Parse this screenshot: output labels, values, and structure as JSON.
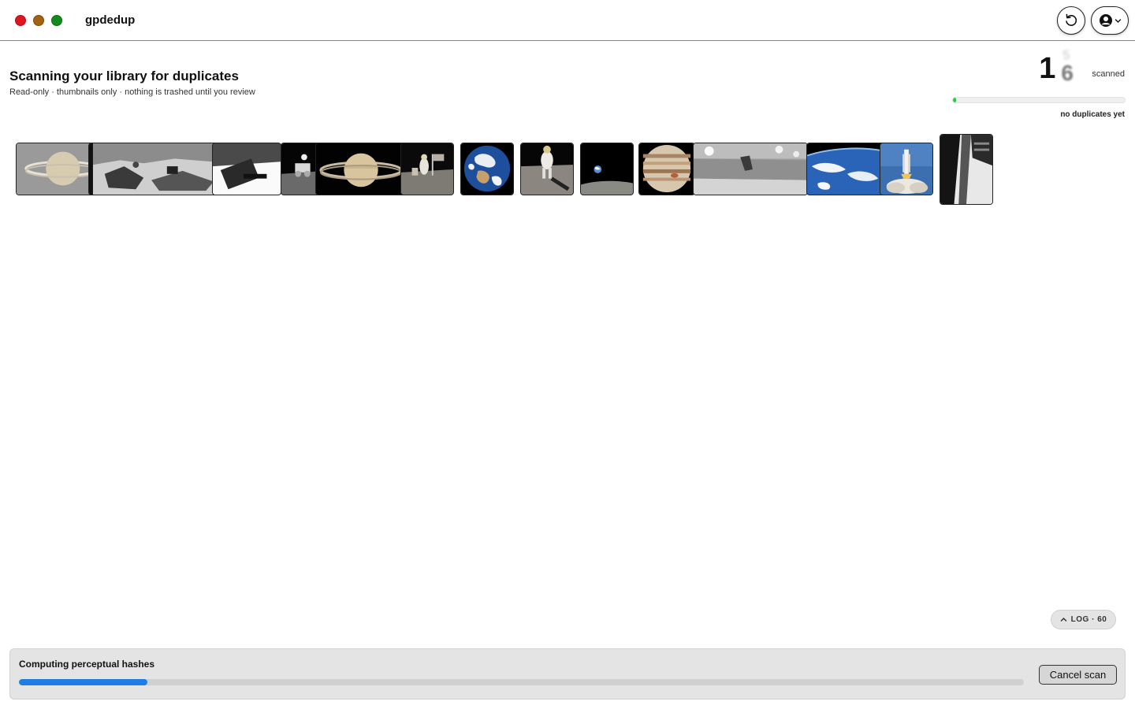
{
  "window": {
    "title": "gpdedup",
    "refresh_icon": "refresh-icon",
    "account_icon": "account-icon"
  },
  "header": {
    "title": "Scanning your library for duplicates",
    "subtitle": "Read-only · thumbnails only · nothing is trashed until you review"
  },
  "counter": {
    "digit": "1",
    "rolling_digit": "6",
    "ghost_digit": "5",
    "label": "scanned",
    "duplicates_status": "no duplicates yet",
    "mini_progress": 0.02,
    "accent": "#27c93f"
  },
  "thumbnails": [
    {
      "subject": "saturn"
    },
    {
      "subject": "mars-surface"
    },
    {
      "subject": "spacecraft-bw"
    },
    {
      "subject": "lunar-rover"
    },
    {
      "subject": "saturn"
    },
    {
      "subject": "astronaut-flag"
    },
    {
      "subject": "earth"
    },
    {
      "subject": "astronaut-moon"
    },
    {
      "subject": "earthrise"
    },
    {
      "subject": "jupiter"
    },
    {
      "subject": "mars-panorama"
    },
    {
      "subject": "earth-orbit"
    },
    {
      "subject": "shuttle-launch"
    },
    {
      "subject": "spacecraft-closeup"
    }
  ],
  "log": {
    "label": "LOG · 60",
    "icon": "chevron-up-icon"
  },
  "status": {
    "text": "Computing perceptual hashes",
    "progress": 0.128,
    "accent": "#1f7ee6",
    "cancel_label": "Cancel scan"
  }
}
